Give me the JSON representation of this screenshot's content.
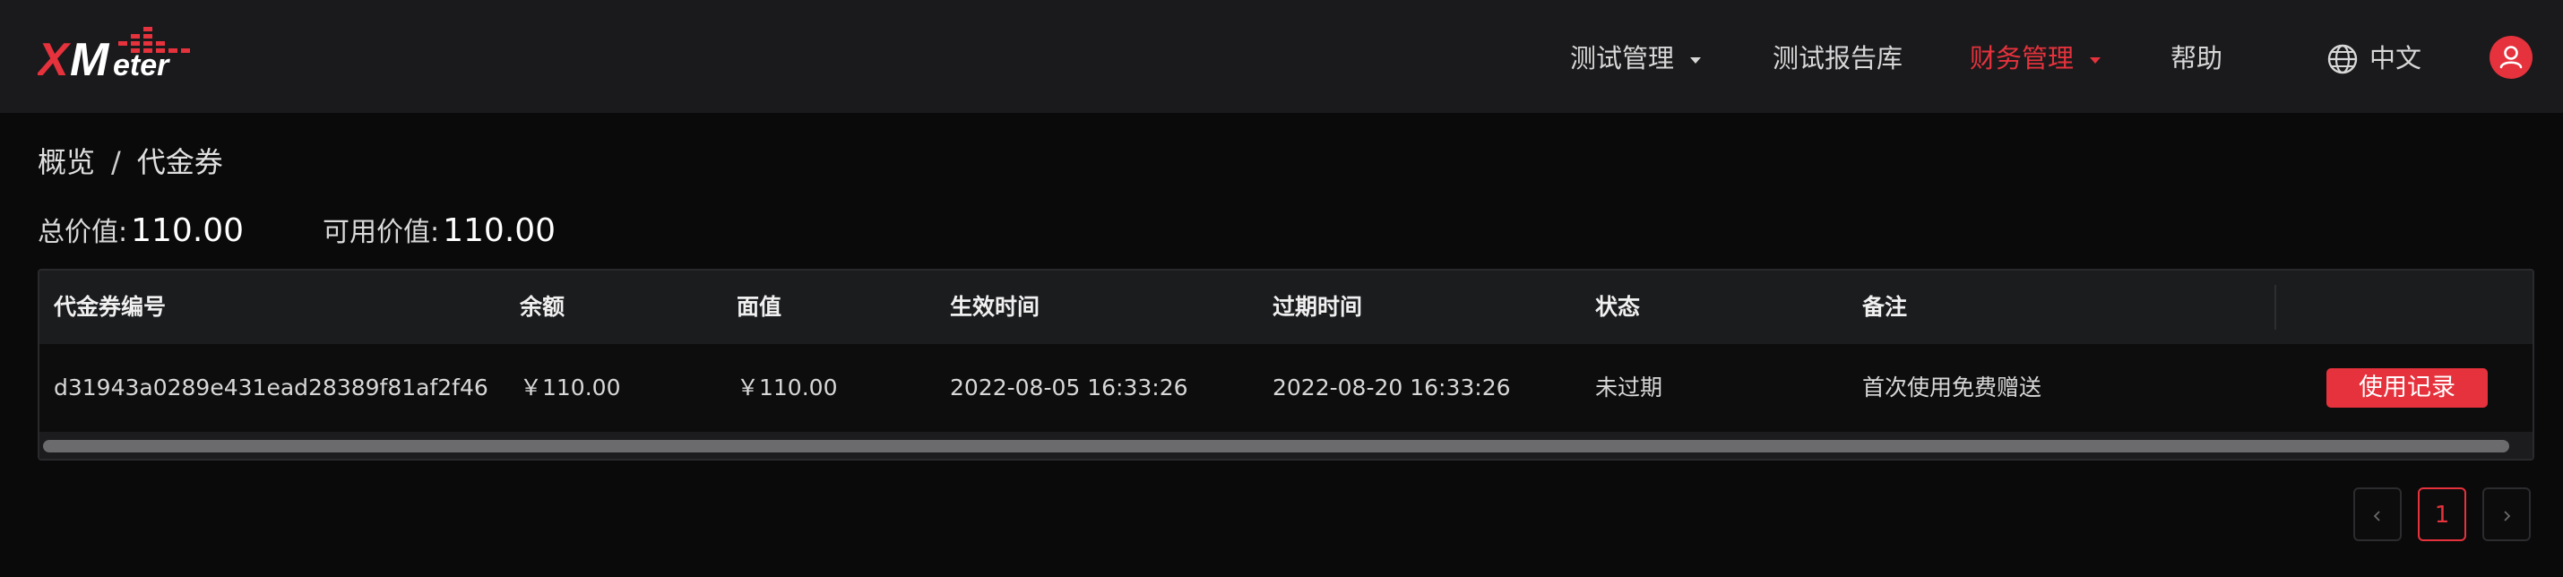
{
  "brand": {
    "logo_text": "XMeter",
    "accent_color": "#e5323c"
  },
  "nav": {
    "items": [
      {
        "label": "测试管理",
        "has_dropdown": true,
        "active": false
      },
      {
        "label": "测试报告库",
        "has_dropdown": false,
        "active": false
      },
      {
        "label": "财务管理",
        "has_dropdown": true,
        "active": true
      },
      {
        "label": "帮助",
        "has_dropdown": false,
        "active": false
      }
    ],
    "language": {
      "icon": "globe-icon",
      "label": "中文"
    },
    "avatar_icon": "user-icon"
  },
  "breadcrumb": {
    "items": [
      "概览",
      "代金券"
    ],
    "separator": "/"
  },
  "summary": {
    "total_label": "总价值:",
    "total_value": "110.00",
    "available_label": "可用价值:",
    "available_value": "110.00"
  },
  "table": {
    "columns": [
      "代金券编号",
      "余额",
      "面值",
      "生效时间",
      "过期时间",
      "状态",
      "备注"
    ],
    "rows": [
      {
        "id": "d31943a0289e431ead28389f81af2f46",
        "balance": "￥110.00",
        "face_value": "￥110.00",
        "effective_time": "2022-08-05 16:33:26",
        "expire_time": "2022-08-20 16:33:26",
        "status": "未过期",
        "remark": "首次使用免费赠送",
        "action_label": "使用记录"
      }
    ]
  },
  "pagination": {
    "prev_icon": "chevron-left-icon",
    "current_page": "1",
    "next_icon": "chevron-right-icon"
  }
}
